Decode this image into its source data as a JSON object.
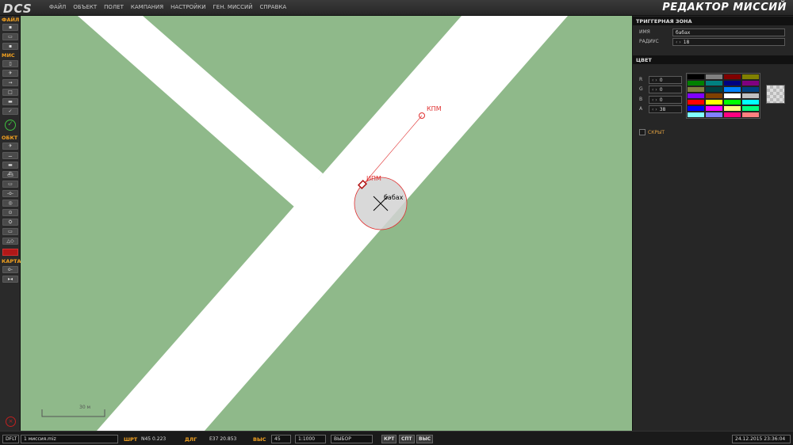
{
  "app": {
    "logo": "DCS",
    "title": "РЕДАКТОР МИССИЙ"
  },
  "menu": [
    "ФАЙЛ",
    "ОБЪЕКТ",
    "ПОЛЕТ",
    "КАМПАНИЯ",
    "НАСТРОЙКИ",
    "ГЕН. МИССИЙ",
    "СПРАВКА"
  ],
  "toolbar": {
    "file_header": "ФАЙЛ",
    "mis_header": "МИС",
    "obj_header": "ОБКТ",
    "map_header": "КАРТА"
  },
  "map": {
    "zone_label": "бабах",
    "ipm_label": "ИПМ",
    "kpm_label": "КПМ",
    "scale_label": "30 м",
    "colors": {
      "ground": "#8fb98a",
      "runway": "#ffffff",
      "zone_fill": "#d4d4d4",
      "zone_stroke": "#e03030",
      "route": "#e03030"
    }
  },
  "panel": {
    "header": "ТРИГГЕРНАЯ ЗОНА",
    "name_label": "ИМЯ",
    "name_value": "бабах",
    "radius_label": "РАДИУС",
    "radius_value": "18",
    "color_header": "ЦВЕТ",
    "r_label": "R",
    "r_value": "0",
    "g_label": "G",
    "g_value": "0",
    "b_label": "B",
    "b_value": "0",
    "a_label": "A",
    "a_value": "38",
    "hidden_label": "СКРЫТ",
    "palette": [
      "#000000",
      "#808080",
      "#800000",
      "#808000",
      "#008000",
      "#008080",
      "#000080",
      "#800080",
      "#808040",
      "#004040",
      "#0080ff",
      "#004080",
      "#8000ff",
      "#804000",
      "#ffffff",
      "#c0c0c0",
      "#ff0000",
      "#ffff00",
      "#00ff00",
      "#00ffff",
      "#0000ff",
      "#ff00ff",
      "#ffff80",
      "#00ff80",
      "#80ffff",
      "#8080ff",
      "#ff0080",
      "#ff8080"
    ]
  },
  "status": {
    "profile": "DFLT",
    "mission_file": "1 миссия.miz",
    "lat_label": "ШРТ",
    "lat_value": "N45  0.223",
    "lon_label": "ДЛГ",
    "lon_value": "E37 20.853",
    "alt_label": "ВЫС",
    "alt_value": "45",
    "scale": "1:1000",
    "mode": "ВЫБОР",
    "btn_map": "КРТ",
    "btn_sat": "СПТ",
    "btn_alt": "ВЫС",
    "datetime": "24.12.2015 23:36:04"
  }
}
